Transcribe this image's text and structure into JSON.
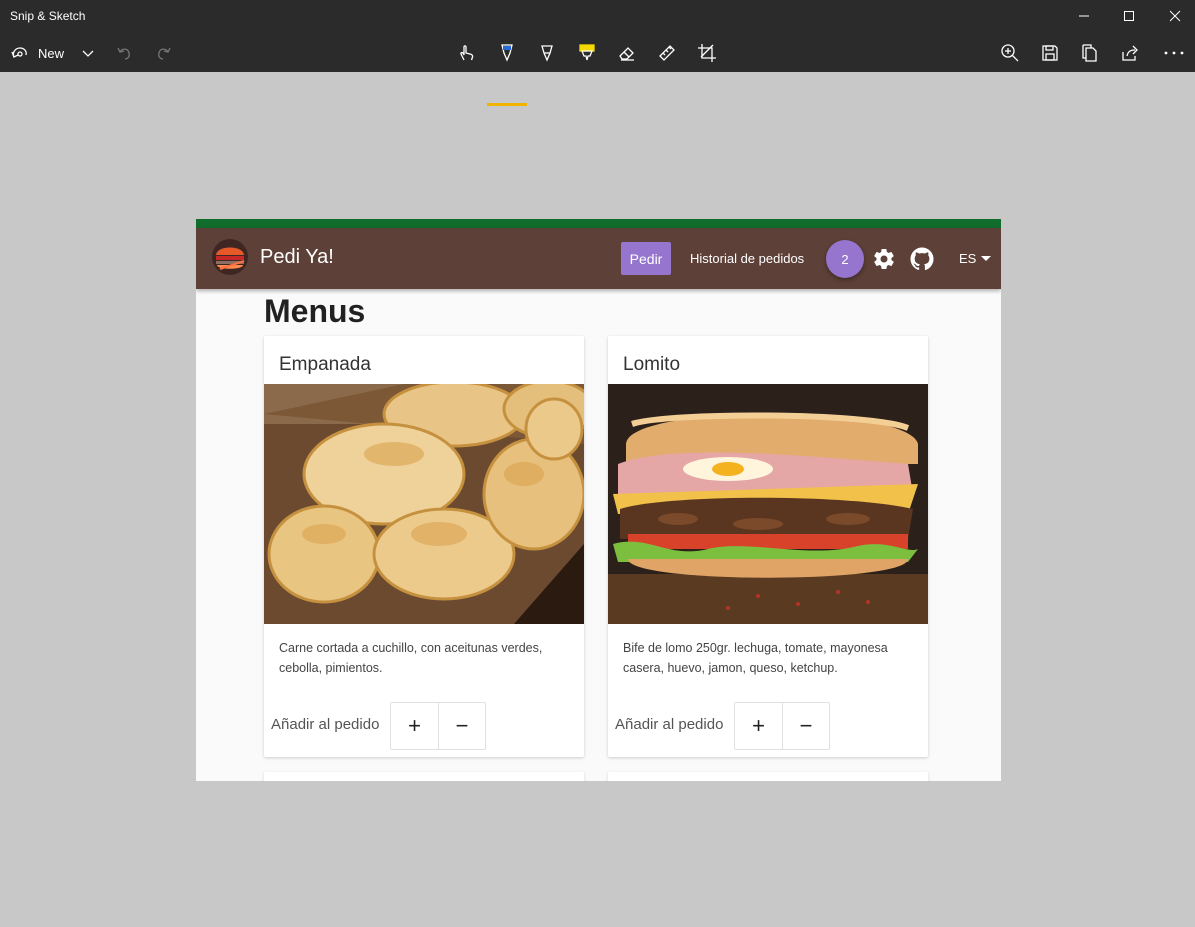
{
  "window": {
    "title": "Snip & Sketch"
  },
  "toolbar": {
    "new_label": "New",
    "tools": [
      "touch-writing-icon",
      "ballpoint-pen-icon",
      "pencil-icon",
      "highlighter-icon",
      "eraser-icon",
      "ruler-icon",
      "crop-icon"
    ],
    "active_tool": "ballpoint-pen-icon",
    "accent_color": "#f0b400"
  },
  "app": {
    "brand_name": "Pedi Ya!",
    "nav": {
      "order_button": "Pedir",
      "history_link": "Historial de pedidos",
      "cart_count": "2",
      "language": "ES"
    },
    "colors": {
      "top_strip": "#116d2b",
      "navbar": "#5d4037",
      "accent": "#9575cd"
    },
    "page_title": "Menus",
    "menus": [
      {
        "title": "Empanada",
        "image": "empanadas-photo",
        "description": "Carne cortada a cuchillo, con aceitunas verdes, cebolla, pimientos.",
        "add_label": "Añadir al pedido",
        "plus": "+",
        "minus": "−"
      },
      {
        "title": "Lomito",
        "image": "lomito-sandwich-photo",
        "description": "Bife de lomo 250gr. lechuga, tomate, mayonesa casera, huevo, jamon, queso, ketchup.",
        "add_label": "Añadir al pedido",
        "plus": "+",
        "minus": "−"
      }
    ]
  }
}
